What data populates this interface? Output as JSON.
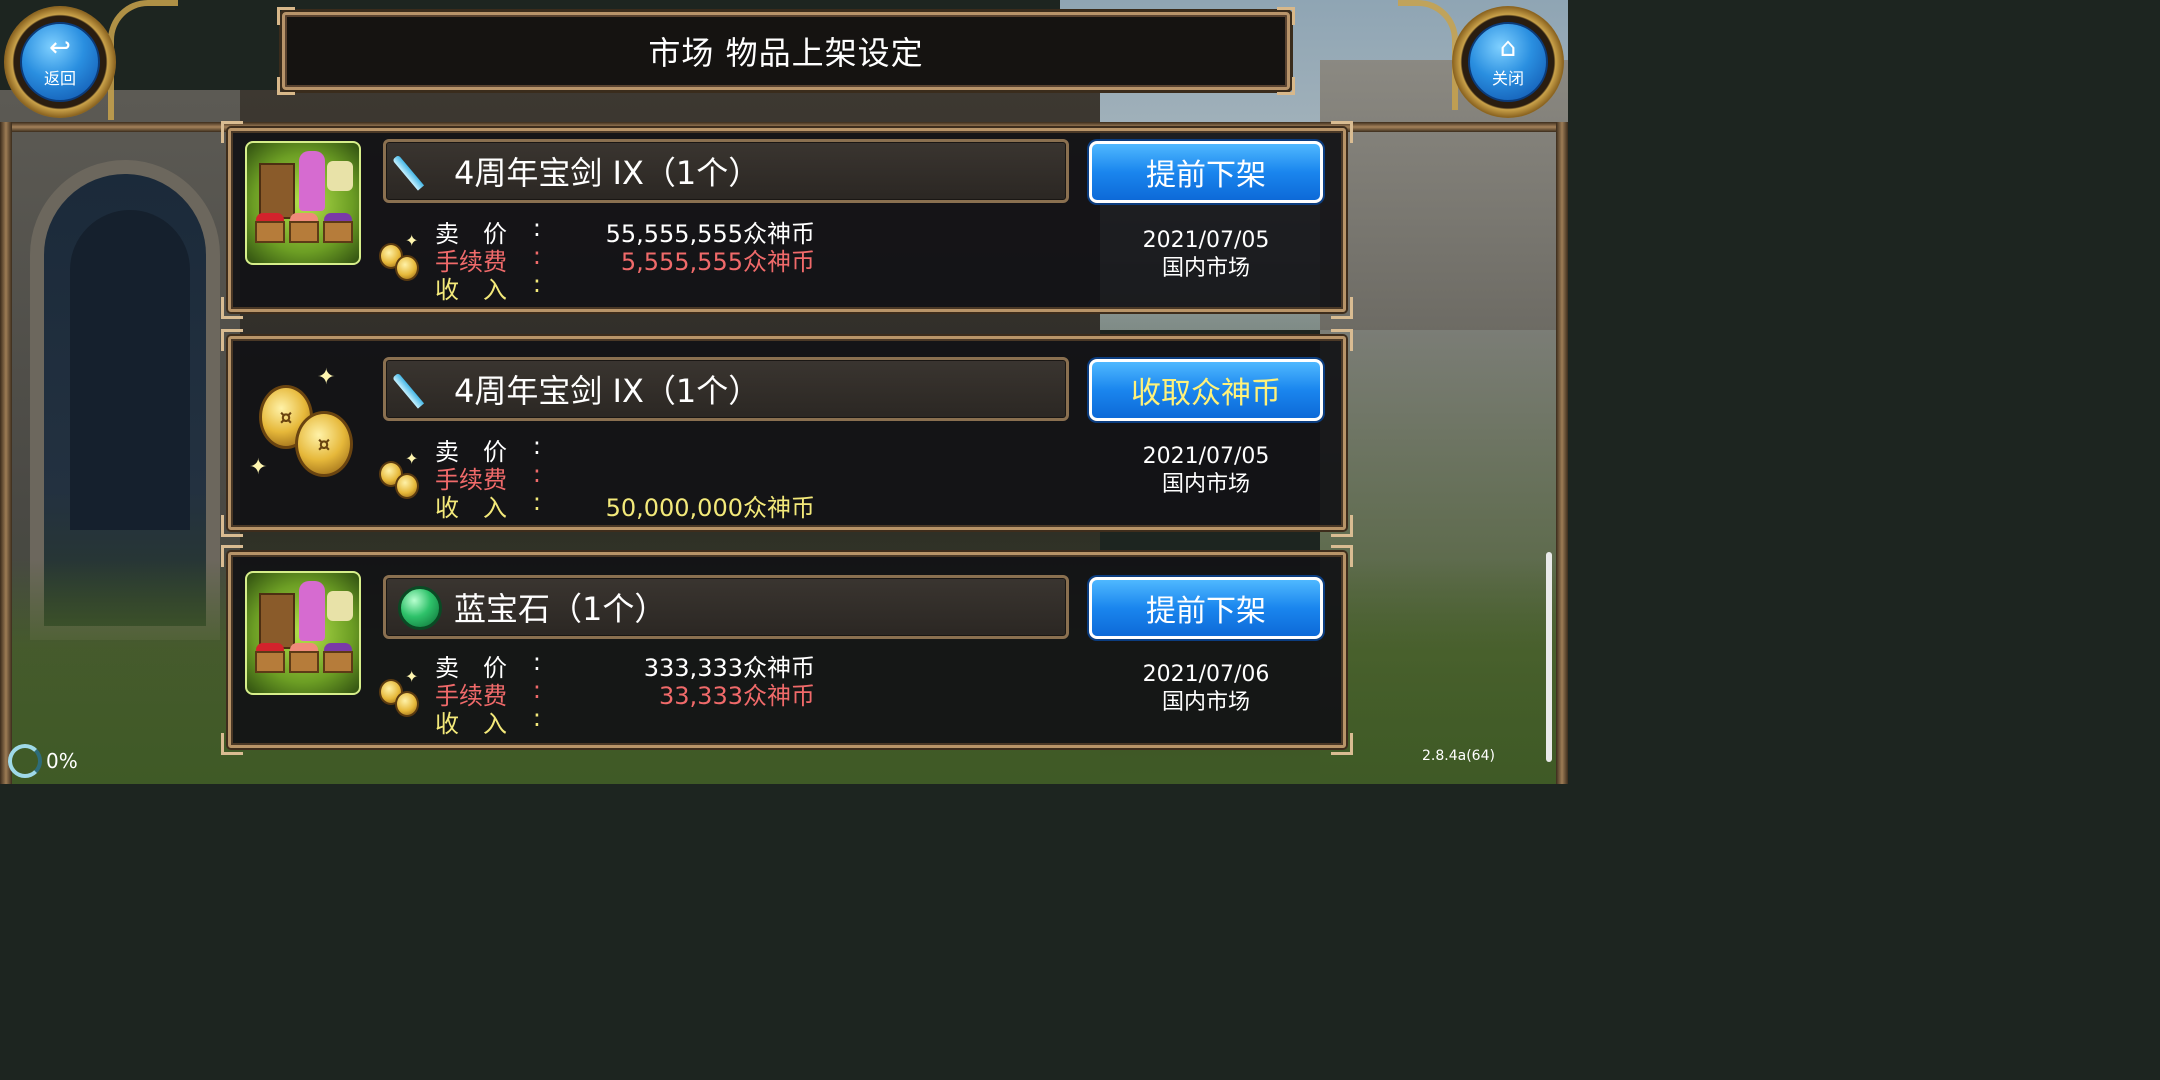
{
  "header": {
    "title": "市场 物品上架设定",
    "back_label": "返回",
    "close_label": "关闭"
  },
  "listings": [
    {
      "item_name": "4周年宝剑 IX（1个）",
      "item_icon": "sword-icon",
      "thumb_icon": "market-stall-icon",
      "action_label": "提前下架",
      "price_label": "卖",
      "price_label_2": "价",
      "price_value": "55,555,555众神币",
      "fee_label": "手续费",
      "fee_value": "5,555,555众神币",
      "income_label": "收",
      "income_label_2": "入",
      "income_value": "",
      "date": "2021/07/05",
      "market": "国内市场"
    },
    {
      "item_name": "4周年宝剑 IX（1个）",
      "item_icon": "sword-icon",
      "thumb_icon": "gold-coins-icon",
      "action_label": "收取众神币",
      "price_label": "卖",
      "price_label_2": "价",
      "price_value": "",
      "fee_label": "手续费",
      "fee_value": "",
      "income_label": "收",
      "income_label_2": "入",
      "income_value": "50,000,000众神币",
      "date": "2021/07/05",
      "market": "国内市场"
    },
    {
      "item_name": "蓝宝石（1个）",
      "item_icon": "gem-icon",
      "thumb_icon": "market-stall-icon",
      "action_label": "提前下架",
      "price_label": "卖",
      "price_label_2": "价",
      "price_value": "333,333众神币",
      "fee_label": "手续费",
      "fee_value": "33,333众神币",
      "income_label": "收",
      "income_label_2": "入",
      "income_value": "",
      "date": "2021/07/06",
      "market": "国内市场"
    }
  ],
  "colon": ":",
  "footer": {
    "loading_percent": "0%",
    "version": "2.8.4a(64)"
  },
  "colors": {
    "button_blue": "#1a86ee",
    "fee_red": "#f06a6a",
    "income_yellow": "#f3e97a",
    "frame_bronze": "#b89468"
  }
}
